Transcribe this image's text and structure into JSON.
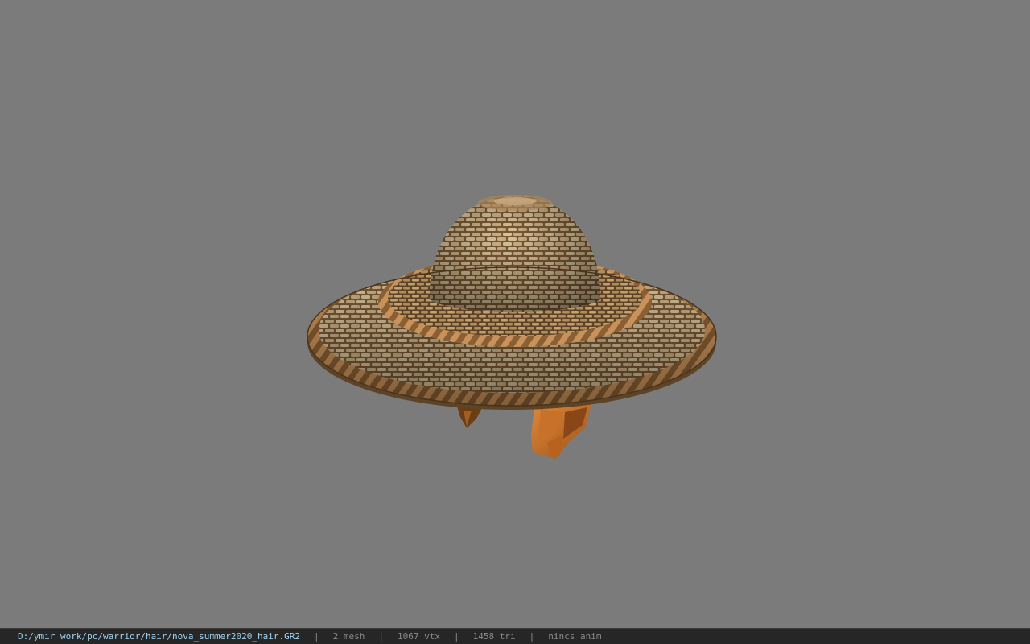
{
  "viewport": {
    "background": "#7b7b7b",
    "model_icon": "straw-hat-model"
  },
  "statusbar": {
    "file_path": "D:/ymir work/pc/warrior/hair/nova_summer2020_hair.GR2",
    "separator": "|",
    "mesh_count": "2 mesh",
    "vertex_count": "1067 vtx",
    "triangle_count": "1458 tri",
    "anim_status": "nincs anim"
  },
  "colors": {
    "statusbar_bg": "#262626",
    "path_text": "#9fd4f0",
    "stat_text": "#8a8a8a",
    "straw_light": "#d6bd93",
    "straw_mid": "#a9865a",
    "straw_dark": "#6b4c2c",
    "ribbon": "#c8742a"
  }
}
